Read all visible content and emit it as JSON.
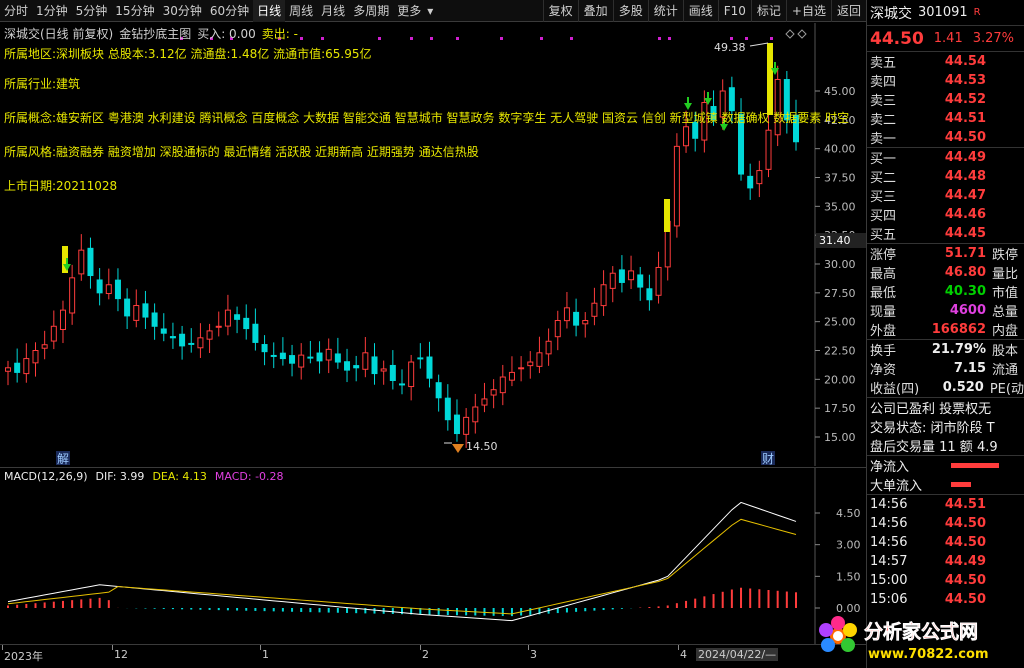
{
  "toolbar": {
    "periods": [
      "分时",
      "1分钟",
      "5分钟",
      "15分钟",
      "30分钟",
      "60分钟",
      "日线",
      "周线",
      "月线",
      "多周期",
      "更多"
    ],
    "active_period": "日线",
    "more_arrow": "▾",
    "buttons": [
      "复权",
      "叠加",
      "多股",
      "统计",
      "画线",
      "F10",
      "标记",
      "+自选",
      "返回"
    ]
  },
  "chart": {
    "stock_name": "深城交(日线 前复权)",
    "indicator": "金钻抄底主图",
    "buy_label": "买入: 0.00",
    "sell_label": "卖出: -",
    "info_region": "所属地区:深圳板块",
    "info_total_shares": "总股本:3.12亿",
    "info_float_shares": "流通盘:1.48亿",
    "info_float_value": "流通市值:65.95亿",
    "info_industry": "所属行业:建筑",
    "info_concepts": "所属概念:雄安新区 粤港澳 水利建设 腾讯概念 百度概念 大数据 智能交通 智慧城市 智慧政务 数字孪生 无人驾驶 国资云 信创 新型城镇 数据确权 数据要素 时空",
    "info_styles": "所属风格:融资融券 融资增加 深股通标的 最近情绪 活跃股 近期新高 近期强势 通达信热股",
    "info_listed": "上市日期:20211028",
    "high_marker": "49.38",
    "low_marker": "14.50",
    "current_price_tag": "31.40",
    "event_jie": "解",
    "event_cai": "财",
    "y_ticks": [
      "45.00",
      "42.50",
      "40.00",
      "37.50",
      "35.00",
      "32.50",
      "30.00",
      "27.50",
      "25.00",
      "22.50",
      "20.00",
      "17.50",
      "15.00"
    ]
  },
  "macd": {
    "name": "MACD(12,26,9)",
    "dif": "DIF: 3.99",
    "dea": "DEA: 4.13",
    "macd": "MACD: -0.28",
    "y_ticks": [
      "4.50",
      "3.00",
      "1.50",
      "0.00"
    ]
  },
  "date_axis": {
    "labels": [
      "2023年",
      "12",
      "1",
      "2",
      "3",
      "4",
      "2024/04/22/—"
    ]
  },
  "quote": {
    "name": "深城交",
    "code": "301091",
    "badge": "R",
    "price": "44.50",
    "change": "1.41",
    "change_pct": "3.27%",
    "asks": [
      {
        "label": "卖五",
        "price": "44.54"
      },
      {
        "label": "卖四",
        "price": "44.53"
      },
      {
        "label": "卖三",
        "price": "44.52"
      },
      {
        "label": "卖二",
        "price": "44.51"
      },
      {
        "label": "卖一",
        "price": "44.50"
      }
    ],
    "bids": [
      {
        "label": "买一",
        "price": "44.49"
      },
      {
        "label": "买二",
        "price": "44.48"
      },
      {
        "label": "买三",
        "price": "44.47"
      },
      {
        "label": "买四",
        "price": "44.46"
      },
      {
        "label": "买五",
        "price": "44.45"
      }
    ],
    "stats": [
      {
        "label": "涨停",
        "value": "51.71",
        "color": "#ff3c3c",
        "extra": "跌停"
      },
      {
        "label": "最高",
        "value": "46.80",
        "color": "#ff3c3c",
        "extra": "量比"
      },
      {
        "label": "最低",
        "value": "40.30",
        "color": "#00d100",
        "extra": "市值"
      },
      {
        "label": "现量",
        "value": "4600",
        "color": "#e040e0",
        "extra": "总量"
      },
      {
        "label": "外盘",
        "value": "166862",
        "color": "#ff3c3c",
        "extra": "内盘"
      }
    ],
    "stats2": [
      {
        "label": "换手",
        "value": "21.79%",
        "extra": "股本"
      },
      {
        "label": "净资",
        "value": "7.15",
        "extra": "流通"
      },
      {
        "label": "收益(四)",
        "value": "0.520",
        "extra": "PE(动"
      }
    ],
    "company_status": "公司已盈利 投票权无",
    "trade_status": "交易状态: 闭市阶段 T",
    "after_hours": "盘后交易量 11 额 4.9",
    "net_inflow": "净流入",
    "big_inflow": "大单流入",
    "ticks": [
      {
        "time": "14:56",
        "price": "44.51"
      },
      {
        "time": "14:56",
        "price": "44.50"
      },
      {
        "time": "14:56",
        "price": "44.50"
      },
      {
        "time": "14:57",
        "price": "44.49"
      },
      {
        "time": "15:00",
        "price": "44.50"
      },
      {
        "time": "15:06",
        "price": "44.50"
      }
    ]
  },
  "watermark": {
    "text": "分析家公式网",
    "url": "www.70822.com"
  },
  "colors": {
    "up": "#ff3c3c",
    "down": "#00d8d8",
    "signal": "#e6e600",
    "arrow": "#22cc22"
  }
}
